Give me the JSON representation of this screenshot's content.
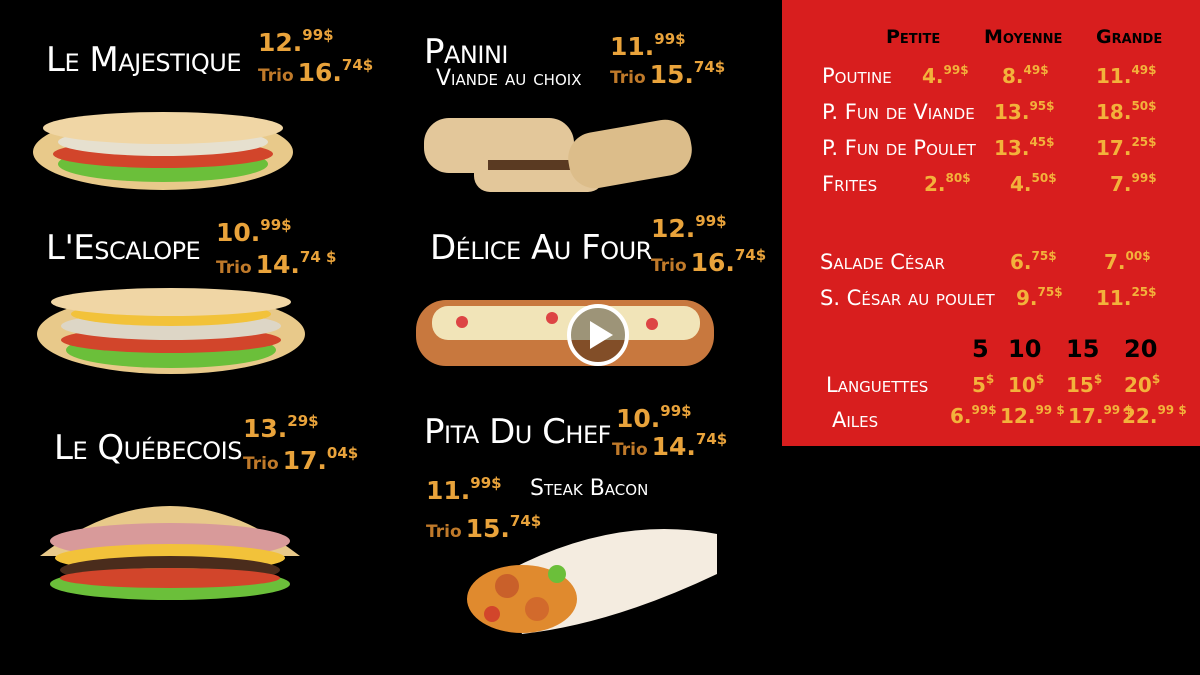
{
  "items": [
    {
      "name": "Le Majestique",
      "price_main": "12.",
      "price_sup": "99$",
      "trio_label": "Trio",
      "trio_main": "16.",
      "trio_sup": "74$"
    },
    {
      "name": "L'Escalope",
      "price_main": "10.",
      "price_sup": "99$",
      "trio_label": "Trio",
      "trio_main": "14.",
      "trio_sup": "74 $"
    },
    {
      "name": "Le Québecois",
      "price_main": "13.",
      "price_sup": "29$",
      "trio_label": "Trio",
      "trio_main": "17.",
      "trio_sup": "04$"
    },
    {
      "name": "Panini",
      "subtitle": "Viande au choix",
      "price_main": "11.",
      "price_sup": "99$",
      "trio_label": "Trio",
      "trio_main": "15.",
      "trio_sup": "74$"
    },
    {
      "name": "Délice Au Four",
      "price_main": "12.",
      "price_sup": "99$",
      "trio_label": "Trio",
      "trio_main": "16.",
      "trio_sup": "74$"
    },
    {
      "name": "Pita Du Chef",
      "price_main": "10.",
      "price_sup": "99$",
      "trio_label": "Trio",
      "trio_main": "14.",
      "trio_sup": "74$"
    },
    {
      "name": "Steak Bacon",
      "price_main": "11.",
      "price_sup": "99$",
      "trio_label": "Trio",
      "trio_main": "15.",
      "trio_sup": "74$"
    }
  ],
  "panel": {
    "headers": [
      "Petite",
      "Moyenne",
      "Grande"
    ],
    "rows": [
      {
        "label": "Poutine",
        "prices": [
          [
            "4.",
            "99$"
          ],
          [
            "8.",
            "49$"
          ],
          [
            "11.",
            "49$"
          ]
        ]
      },
      {
        "label": "P. Fun de Viande",
        "prices": [
          [
            "13.",
            "95$"
          ],
          [
            "18.",
            "50$"
          ]
        ]
      },
      {
        "label": "P. Fun de Poulet",
        "prices": [
          [
            "13.",
            "45$"
          ],
          [
            "17.",
            "25$"
          ]
        ]
      },
      {
        "label": "Frites",
        "prices": [
          [
            "2.",
            "80$"
          ],
          [
            "4.",
            "50$"
          ],
          [
            "7.",
            "99$"
          ]
        ]
      },
      {
        "label": "Salade César",
        "prices": [
          [
            "6.",
            "75$"
          ],
          [
            "7.",
            "00$"
          ]
        ]
      },
      {
        "label": "S. César au poulet",
        "prices": [
          [
            "9.",
            "75$"
          ],
          [
            "11.",
            "25$"
          ]
        ]
      }
    ],
    "count_headers": [
      "5",
      "10",
      "15",
      "20"
    ],
    "languettes": {
      "label": "Languettes",
      "prices": [
        [
          "5",
          "$"
        ],
        [
          "10",
          "$"
        ],
        [
          "15",
          "$"
        ],
        [
          "20",
          "$"
        ]
      ]
    },
    "ailes": {
      "label": "Ailes",
      "prices": [
        [
          "6.",
          "99$"
        ],
        [
          "12.",
          "99 $"
        ],
        [
          "17.",
          "99 $"
        ],
        [
          "22.",
          "99 $"
        ]
      ]
    }
  },
  "video": {
    "play_icon": "play-icon"
  },
  "colors": {
    "panel": "#d81e1e",
    "price": "#e9a33b",
    "trio": "#c07a2a"
  }
}
